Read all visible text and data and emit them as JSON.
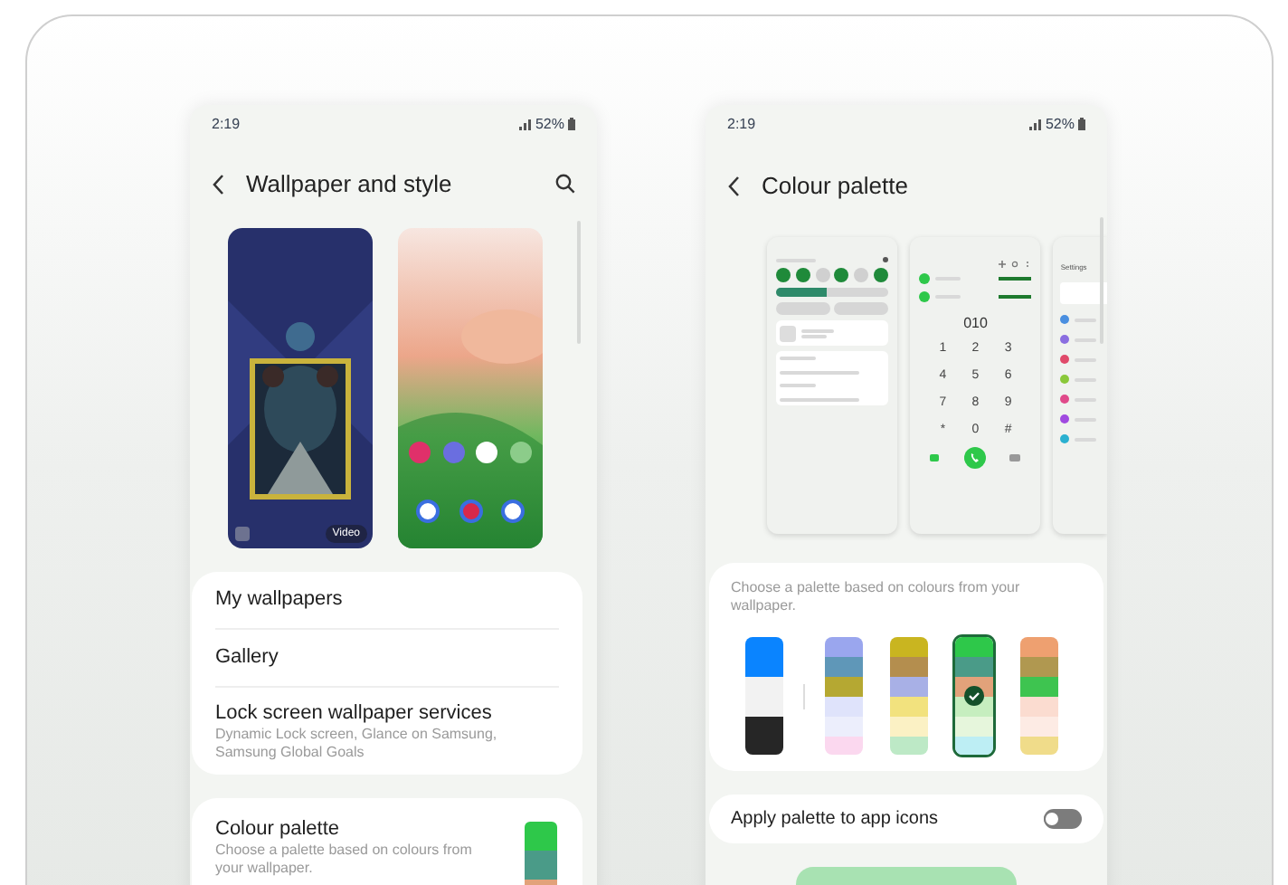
{
  "left_screen": {
    "status_bar": {
      "time": "2:19",
      "battery": "52%"
    },
    "header": {
      "title": "Wallpaper and style"
    },
    "wallpapers": [
      {
        "kind": "lock",
        "badge": "Video"
      },
      {
        "kind": "home"
      }
    ],
    "menu": [
      {
        "title": "My wallpapers"
      },
      {
        "title": "Gallery"
      },
      {
        "title": "Lock screen wallpaper services",
        "subtitle": "Dynamic Lock screen, Glance on Samsung, Samsung Global Goals"
      }
    ],
    "palette_item": {
      "title": "Colour palette",
      "subtitle": "Choose a palette based on colours from your wallpaper.",
      "bands": [
        {
          "color": "#2ec84a"
        },
        {
          "color": "#4a9b88"
        },
        {
          "color": "#e2a27a"
        }
      ]
    }
  },
  "right_screen": {
    "status_bar": {
      "time": "2:19",
      "battery": "52%"
    },
    "header": {
      "title": "Colour palette"
    },
    "previews": [
      {
        "kind": "quick_panel"
      },
      {
        "kind": "dialer",
        "number": "010",
        "keys": [
          "1",
          "2",
          "3",
          "4",
          "5",
          "6",
          "7",
          "8",
          "9",
          "*",
          "0",
          "#"
        ]
      },
      {
        "kind": "settings",
        "title": "Settings"
      }
    ],
    "palette_card": {
      "description": "Choose a palette based on colours from your wallpaper.",
      "palettes": [
        {
          "bands": [
            {
              "color": "#0a84ff"
            },
            {
              "color": "#f2f2f2"
            },
            {
              "color": "#262626"
            }
          ],
          "selected": false
        },
        {
          "bands": [
            {
              "color": "#9aa6ee"
            },
            {
              "color": "#5f97b8"
            },
            {
              "color": "#b5a832"
            },
            {
              "color": "#dfe3fb"
            },
            {
              "color": "#eceefc"
            },
            {
              "color": "#fbd8ef"
            }
          ],
          "selected": false
        },
        {
          "bands": [
            {
              "color": "#c9b520"
            },
            {
              "color": "#b48e4e"
            },
            {
              "color": "#a8b0e6"
            },
            {
              "color": "#f2e27e"
            },
            {
              "color": "#fbf1c4"
            },
            {
              "color": "#bde9c6"
            }
          ],
          "selected": false
        },
        {
          "bands": [
            {
              "color": "#2ec84a"
            },
            {
              "color": "#4a9b88"
            },
            {
              "color": "#e2a27a"
            },
            {
              "color": "#c6eebf"
            },
            {
              "color": "#e6f6dc"
            },
            {
              "color": "#bdeef4"
            }
          ],
          "selected": true
        },
        {
          "bands": [
            {
              "color": "#eea070"
            },
            {
              "color": "#b09850"
            },
            {
              "color": "#3ec450"
            },
            {
              "color": "#fbdcd0"
            },
            {
              "color": "#fdebe4"
            },
            {
              "color": "#f0dc8a"
            }
          ],
          "selected": false
        }
      ]
    },
    "toggle": {
      "label": "Apply palette to app icons",
      "on": false
    }
  }
}
